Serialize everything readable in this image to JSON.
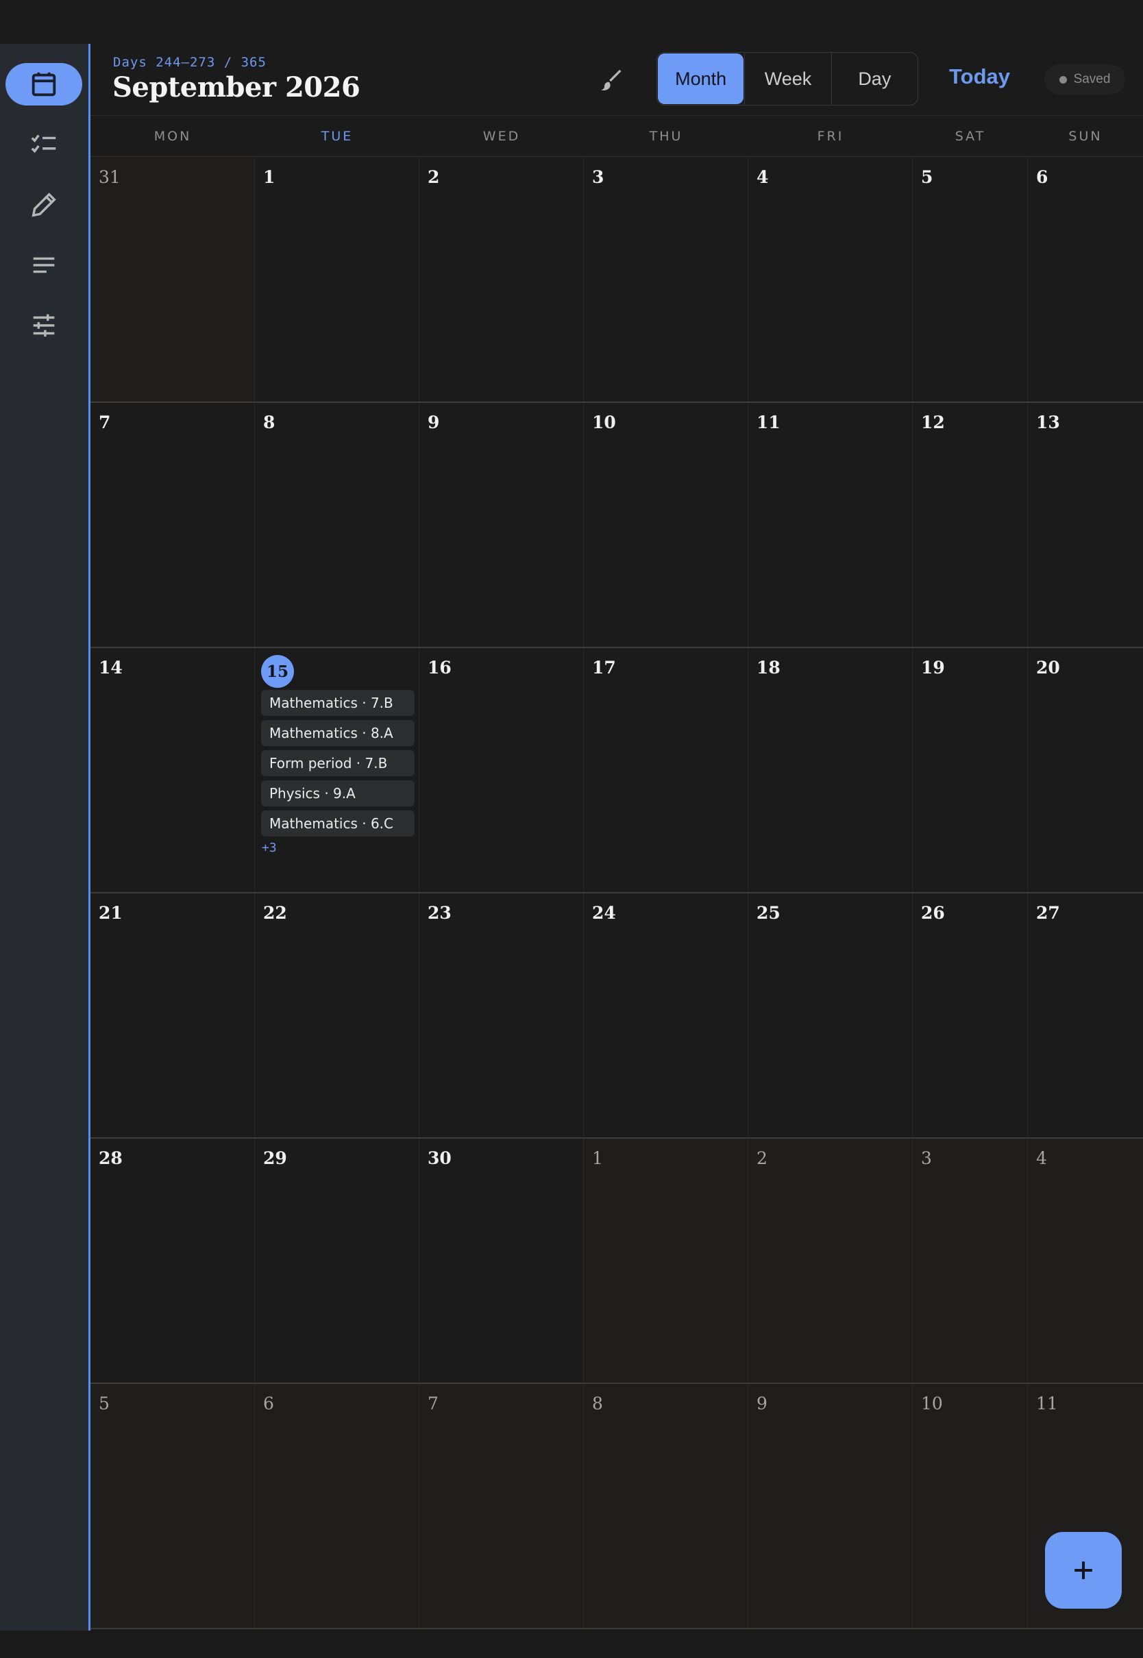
{
  "header": {
    "range_label": "Days 244–273 / 365",
    "title": "September 2026",
    "views": [
      "Month",
      "Week",
      "Day"
    ],
    "active_view": "Month",
    "today_label": "Today",
    "saved_label": "Saved"
  },
  "rail": {
    "items": [
      {
        "icon": "calendar-icon",
        "active": true
      },
      {
        "icon": "checklist-icon",
        "active": false
      },
      {
        "icon": "pencil-icon",
        "active": false
      },
      {
        "icon": "notes-icon",
        "active": false
      },
      {
        "icon": "sliders-icon",
        "active": false
      }
    ]
  },
  "weekdays": [
    "MON",
    "TUE",
    "WED",
    "THU",
    "FRI",
    "SAT",
    "SUN"
  ],
  "today_weekday_index": 1,
  "weeks": [
    [
      {
        "day": "31",
        "current": false
      },
      {
        "day": "1",
        "current": true
      },
      {
        "day": "2",
        "current": true
      },
      {
        "day": "3",
        "current": true
      },
      {
        "day": "4",
        "current": true
      },
      {
        "day": "5",
        "current": true
      },
      {
        "day": "6",
        "current": true
      }
    ],
    [
      {
        "day": "7",
        "current": true
      },
      {
        "day": "8",
        "current": true
      },
      {
        "day": "9",
        "current": true
      },
      {
        "day": "10",
        "current": true
      },
      {
        "day": "11",
        "current": true
      },
      {
        "day": "12",
        "current": true
      },
      {
        "day": "13",
        "current": true
      }
    ],
    [
      {
        "day": "14",
        "current": true
      },
      {
        "day": "15",
        "current": true,
        "today": true,
        "events": [
          "Mathematics · 7.B",
          "Mathematics · 8.A",
          "Form period · 7.B",
          "Physics · 9.A",
          "Mathematics · 6.C"
        ],
        "more": "+3"
      },
      {
        "day": "16",
        "current": true
      },
      {
        "day": "17",
        "current": true
      },
      {
        "day": "18",
        "current": true
      },
      {
        "day": "19",
        "current": true
      },
      {
        "day": "20",
        "current": true
      }
    ],
    [
      {
        "day": "21",
        "current": true
      },
      {
        "day": "22",
        "current": true
      },
      {
        "day": "23",
        "current": true
      },
      {
        "day": "24",
        "current": true
      },
      {
        "day": "25",
        "current": true
      },
      {
        "day": "26",
        "current": true
      },
      {
        "day": "27",
        "current": true
      }
    ],
    [
      {
        "day": "28",
        "current": true
      },
      {
        "day": "29",
        "current": true
      },
      {
        "day": "30",
        "current": true
      },
      {
        "day": "1",
        "current": false
      },
      {
        "day": "2",
        "current": false
      },
      {
        "day": "3",
        "current": false
      },
      {
        "day": "4",
        "current": false
      }
    ],
    [
      {
        "day": "5",
        "current": false
      },
      {
        "day": "6",
        "current": false
      },
      {
        "day": "7",
        "current": false
      },
      {
        "day": "8",
        "current": false
      },
      {
        "day": "9",
        "current": false
      },
      {
        "day": "10",
        "current": false
      },
      {
        "day": "11",
        "current": false
      }
    ]
  ],
  "fab_icon": "plus-icon",
  "colors": {
    "accent": "#6e9bf5",
    "rail": "#272a30",
    "background": "#1b1b1b"
  }
}
